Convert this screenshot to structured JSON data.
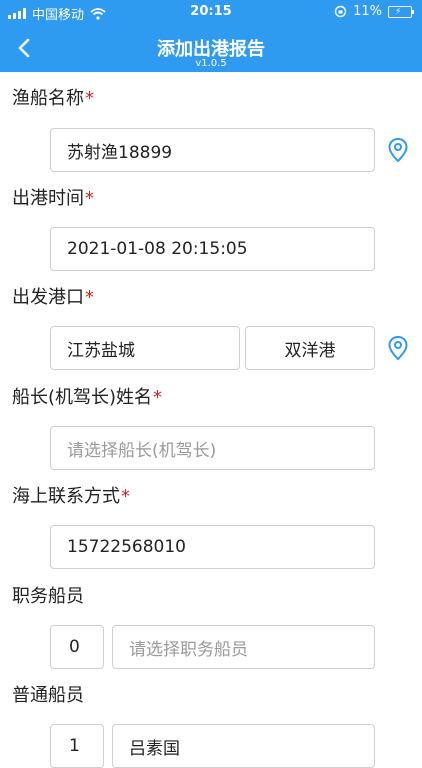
{
  "status": {
    "carrier": "中国移动",
    "time": "20:15",
    "battery": "11%"
  },
  "nav": {
    "title": "添加出港报告",
    "version": "v1.0.5"
  },
  "form": {
    "vessel_name": {
      "label": "渔船名称",
      "required": "*",
      "value": "苏射渔18899"
    },
    "departure_time": {
      "label": "出港时间",
      "required": "*",
      "value": "2021-01-08 20:15:05"
    },
    "departure_port": {
      "label": "出发港口",
      "required": "*",
      "region": "江苏盐城",
      "port": "双洋港"
    },
    "captain": {
      "label": "船长(机驾长)姓名",
      "required": "*",
      "placeholder": "请选择船长(机驾长)"
    },
    "contact": {
      "label": "海上联系方式",
      "required": "*",
      "value": "15722568010"
    },
    "officer_crew": {
      "label": "职务船员",
      "count": "0",
      "placeholder": "请选择职务船员"
    },
    "ordinary_crew": {
      "label": "普通船员",
      "count": "1",
      "value": "吕素国"
    }
  },
  "colors": {
    "primary": "#2f9bf0",
    "required": "#e02020"
  }
}
